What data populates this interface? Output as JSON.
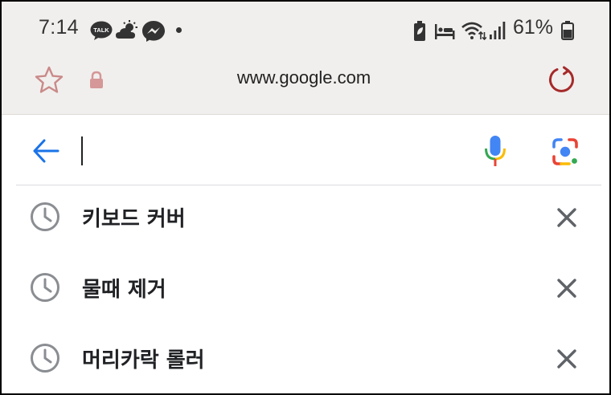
{
  "status_bar": {
    "time": "7:14",
    "battery_percent": "61%",
    "notification_icons": [
      "kakaotalk-icon",
      "weather-icon",
      "messenger-icon",
      "more-dot-icon"
    ],
    "right_icons": [
      "battery-saver-icon",
      "sleep-mode-icon",
      "wifi-icon",
      "signal-icon",
      "battery-icon"
    ],
    "kakao_label": "TALK"
  },
  "address_bar": {
    "url": "www.google.com",
    "favorite_icon": "star-icon",
    "secure_icon": "lock-icon",
    "reload_icon": "reload-icon"
  },
  "search": {
    "value": "",
    "back_icon": "back-arrow-icon",
    "voice_icon": "microphone-icon",
    "lens_icon": "camera-lens-icon"
  },
  "history": [
    {
      "text": "키보드 커버",
      "icon": "history-clock-icon",
      "remove_icon": "close-icon"
    },
    {
      "text": "물때 제거",
      "icon": "history-clock-icon",
      "remove_icon": "close-icon"
    },
    {
      "text": "머리카락 롤러",
      "icon": "history-clock-icon",
      "remove_icon": "close-icon"
    }
  ],
  "colors": {
    "browser_bar_bg": "#f1efed",
    "accent_blue": "#1a73e8",
    "reload_red": "#a52a2a",
    "star_outline": "#c98a8a",
    "lock_color": "#d59797"
  }
}
